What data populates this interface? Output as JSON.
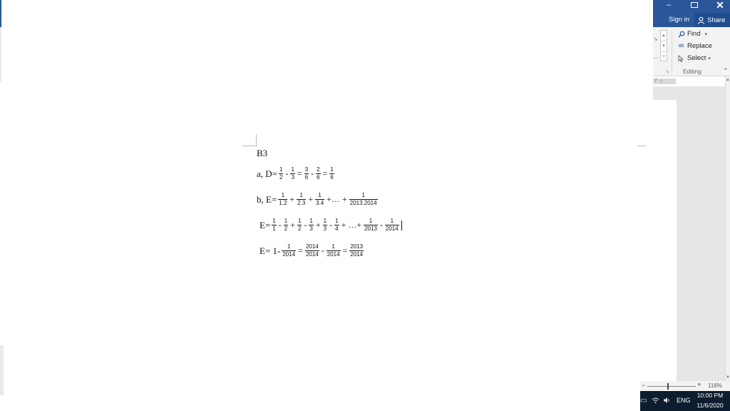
{
  "window": {
    "sign_in": "Sign in",
    "share": "Share",
    "close_glyph": "✕",
    "minimize_glyph": "–"
  },
  "ribbon": {
    "find": "Find",
    "replace": "Replace",
    "select": "Select",
    "group_label": "Editing"
  },
  "status": {
    "zoom": "116%"
  },
  "taskbar": {
    "lang": "ENG",
    "time": "10:00 PM",
    "date": "11/6/2020"
  },
  "document": {
    "heading": "B3",
    "line_a": {
      "prefix": "a, D=",
      "f1": [
        "1",
        "2"
      ],
      "op1": "-",
      "f2": [
        "1",
        "3"
      ],
      "op2": "=",
      "f3": [
        "3",
        "6"
      ],
      "op3": "-",
      "f4": [
        "2",
        "6"
      ],
      "op4": "=",
      "f5": [
        "1",
        "6"
      ]
    },
    "line_b": {
      "prefix": "b, E=",
      "f1": [
        "1",
        "1.2"
      ],
      "op1": "+",
      "f2": [
        "1",
        "2.3"
      ],
      "op2": "+",
      "f3": [
        "1",
        "3.4"
      ],
      "op3": "+… +",
      "f4": [
        "1",
        "2013.2014"
      ]
    },
    "line_c": {
      "prefix": "E=",
      "f1": [
        "1",
        "1"
      ],
      "op1": "-",
      "f2": [
        "1",
        "2"
      ],
      "op2": "+",
      "f3": [
        "1",
        "2"
      ],
      "op3": "-",
      "f4": [
        "1",
        "3"
      ],
      "op4": "+",
      "f5": [
        "1",
        "3"
      ],
      "op5": "-",
      "f6": [
        "1",
        "4"
      ],
      "op6": "+ …+",
      "f7": [
        "1",
        "2013"
      ],
      "op7": "-",
      "f8": [
        "1",
        "2014"
      ]
    },
    "line_d": {
      "prefix": "E= 1-",
      "f1": [
        "1",
        "2014"
      ],
      "op1": "=",
      "f2": [
        "2014",
        "2014"
      ],
      "op2": "-",
      "f3": [
        "1",
        "2014"
      ],
      "op3": "=",
      "f4": [
        "2013",
        "2014"
      ]
    }
  },
  "icons": [
    "find-icon",
    "replace-icon",
    "select-icon",
    "share-icon",
    "maximize-icon",
    "battery-icon",
    "wifi-icon",
    "volume-icon"
  ]
}
